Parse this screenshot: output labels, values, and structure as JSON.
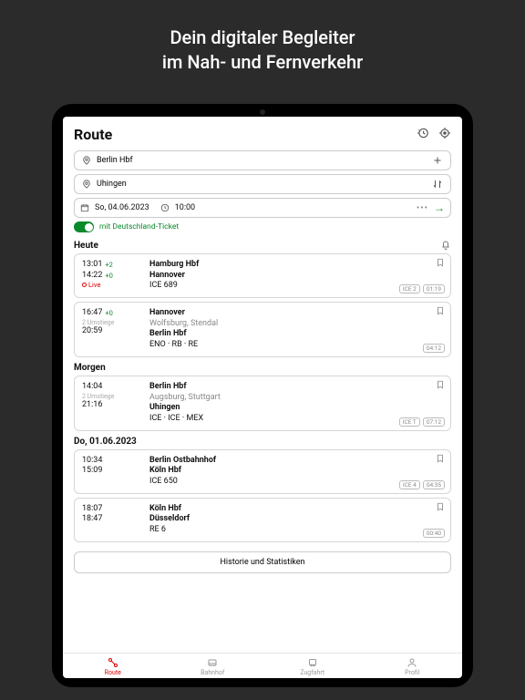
{
  "promo": {
    "line1": "Dein digitaler Begleiter",
    "line2": "im Nah- und Fernverkehr"
  },
  "header": {
    "title": "Route"
  },
  "from": {
    "value": "Berlin Hbf"
  },
  "to": {
    "value": "Uhingen"
  },
  "datetime": {
    "date": "So, 04.06.2023",
    "time": "10:00"
  },
  "ticket": {
    "label": "mit Deutschland-Ticket"
  },
  "sections": [
    {
      "title": "Heute",
      "trips": [
        {
          "t1": "13:01",
          "d1": "+2",
          "t2": "14:22",
          "d2": "+0",
          "sub": "live",
          "subText": "Live",
          "l1": "Hamburg Hbf",
          "l2": "Hannover",
          "l3": "ICE 689",
          "badges": [
            "ICE 2",
            "01:19"
          ]
        },
        {
          "t1": "16:47",
          "d1": "+0",
          "sub": "um",
          "subText": "2 Umstiege",
          "t2": "20:59",
          "l1": "Hannover",
          "via": "Wolfsburg, Stendal",
          "l2": "Berlin Hbf",
          "l3": "ENO · RB · RE",
          "badges": [
            "04:12"
          ]
        }
      ]
    },
    {
      "title": "Morgen",
      "trips": [
        {
          "t1": "14:04",
          "sub": "um",
          "subText": "2 Umstiege",
          "t2": "21:16",
          "l1": "Berlin Hbf",
          "via": "Augsburg, Stuttgart",
          "l2": "Uhingen",
          "l3": "ICE · ICE · MEX",
          "badges": [
            "ICE T",
            "07:12"
          ]
        }
      ]
    },
    {
      "title": "Do, 01.06.2023",
      "trips": [
        {
          "t1": "10:34",
          "t2": "15:09",
          "l1": "Berlin Ostbahnhof",
          "l2": "Köln Hbf",
          "l3": "ICE 650",
          "badges": [
            "ICE 4",
            "04:35"
          ]
        },
        {
          "t1": "18:07",
          "t2": "18:47",
          "l1": "Köln Hbf",
          "l2": "Düsseldorf",
          "l3": "RE 6",
          "badges": [
            "00:40"
          ]
        }
      ]
    }
  ],
  "history_btn": "Historie und Statistiken",
  "tabs": [
    {
      "label": "Route",
      "active": true
    },
    {
      "label": "Bahnhof",
      "active": false
    },
    {
      "label": "Zugfahrt",
      "active": false
    },
    {
      "label": "Profil",
      "active": false
    }
  ]
}
